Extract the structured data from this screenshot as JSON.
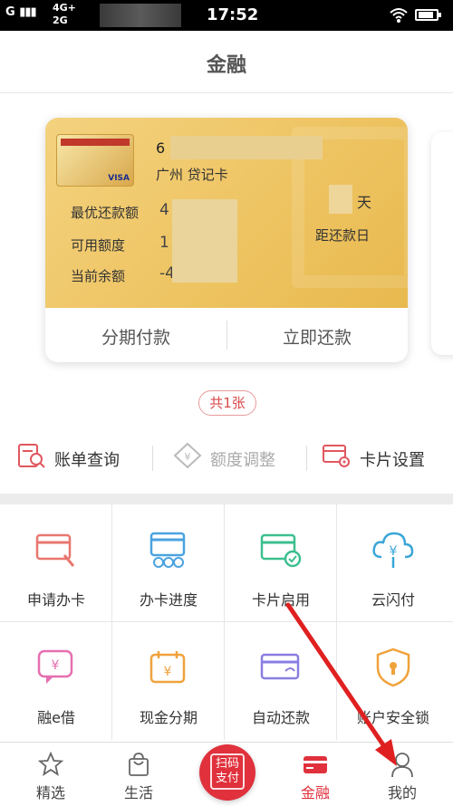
{
  "status_bar": {
    "signal_text": "G",
    "network_top": "4G+",
    "network_bottom": "2G",
    "time": "17:52"
  },
  "header": {
    "title": "金融"
  },
  "card": {
    "number_prefix": "6",
    "card_type": "广州 贷记卡",
    "issuer_logo_text": "VISA",
    "rows": [
      {
        "label": "最优还款额",
        "value": "4"
      },
      {
        "label": "可用额度",
        "value": "1"
      },
      {
        "label": "当前余额",
        "value": "-4"
      }
    ],
    "days_unit": "天",
    "days_label": "距还款日",
    "actions": {
      "installment": "分期付款",
      "repay_now": "立即还款"
    }
  },
  "card_count": "共1张",
  "quick_actions": [
    {
      "label": "账单查询",
      "icon": "bill-search-icon",
      "enabled": true
    },
    {
      "label": "额度调整",
      "icon": "limit-adjust-icon",
      "enabled": false
    },
    {
      "label": "卡片设置",
      "icon": "card-settings-icon",
      "enabled": true
    }
  ],
  "grid": [
    {
      "label": "申请办卡",
      "icon": "apply-card-icon",
      "color": "#e8776f"
    },
    {
      "label": "办卡进度",
      "icon": "card-progress-icon",
      "color": "#4aa3e0"
    },
    {
      "label": "卡片启用",
      "icon": "card-activate-icon",
      "color": "#3cbf8f"
    },
    {
      "label": "云闪付",
      "icon": "cloud-pay-icon",
      "color": "#3aa6d8"
    },
    {
      "label": "融e借",
      "icon": "e-loan-icon",
      "color": "#e56fb0"
    },
    {
      "label": "现金分期",
      "icon": "cash-installment-icon",
      "color": "#f0a23c"
    },
    {
      "label": "自动还款",
      "icon": "auto-repay-icon",
      "color": "#8a7ee0"
    },
    {
      "label": "账户安全锁",
      "icon": "account-lock-icon",
      "color": "#f0a23c"
    }
  ],
  "tabbar": [
    {
      "label": "精选",
      "icon": "star-icon",
      "active": false
    },
    {
      "label": "生活",
      "icon": "bag-icon",
      "active": false
    },
    {
      "label": "扫码支付",
      "icon": "scan-pay-icon",
      "active": false
    },
    {
      "label": "金融",
      "icon": "card-icon",
      "active": true
    },
    {
      "label": "我的",
      "icon": "person-icon",
      "active": false
    }
  ],
  "colors": {
    "accent": "#e0313c",
    "card_gold": "#f0c86a",
    "annotation_arrow": "#e02020"
  }
}
